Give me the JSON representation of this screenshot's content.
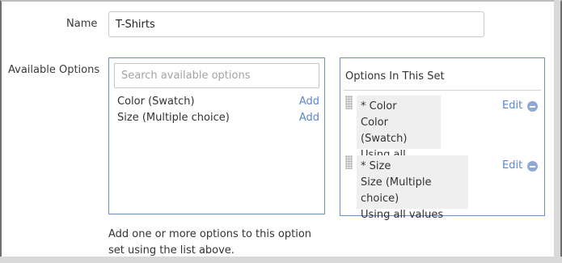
{
  "form": {
    "name_label": "Name",
    "name_value": "T-Shirts",
    "available_label": "Available Options"
  },
  "available": {
    "search_placeholder": "Search available options",
    "items": [
      {
        "label": "Color (Swatch)",
        "action": "Add"
      },
      {
        "label": "Size (Multiple choice)",
        "action": "Add"
      }
    ],
    "help_text": "Add one or more options to this option set using the list above."
  },
  "set": {
    "title": "Options In This Set",
    "items": [
      {
        "line1": "* Color",
        "line2": "Color (Swatch)",
        "line3": "Using all values",
        "edit": "Edit"
      },
      {
        "line1": "* Size",
        "line2": "Size (Multiple choice)",
        "line3": "Using all values",
        "edit": "Edit"
      }
    ]
  },
  "colors": {
    "accent_link": "#5a86cc",
    "box_border": "#6a8fc2",
    "card_bg": "#efefef"
  }
}
